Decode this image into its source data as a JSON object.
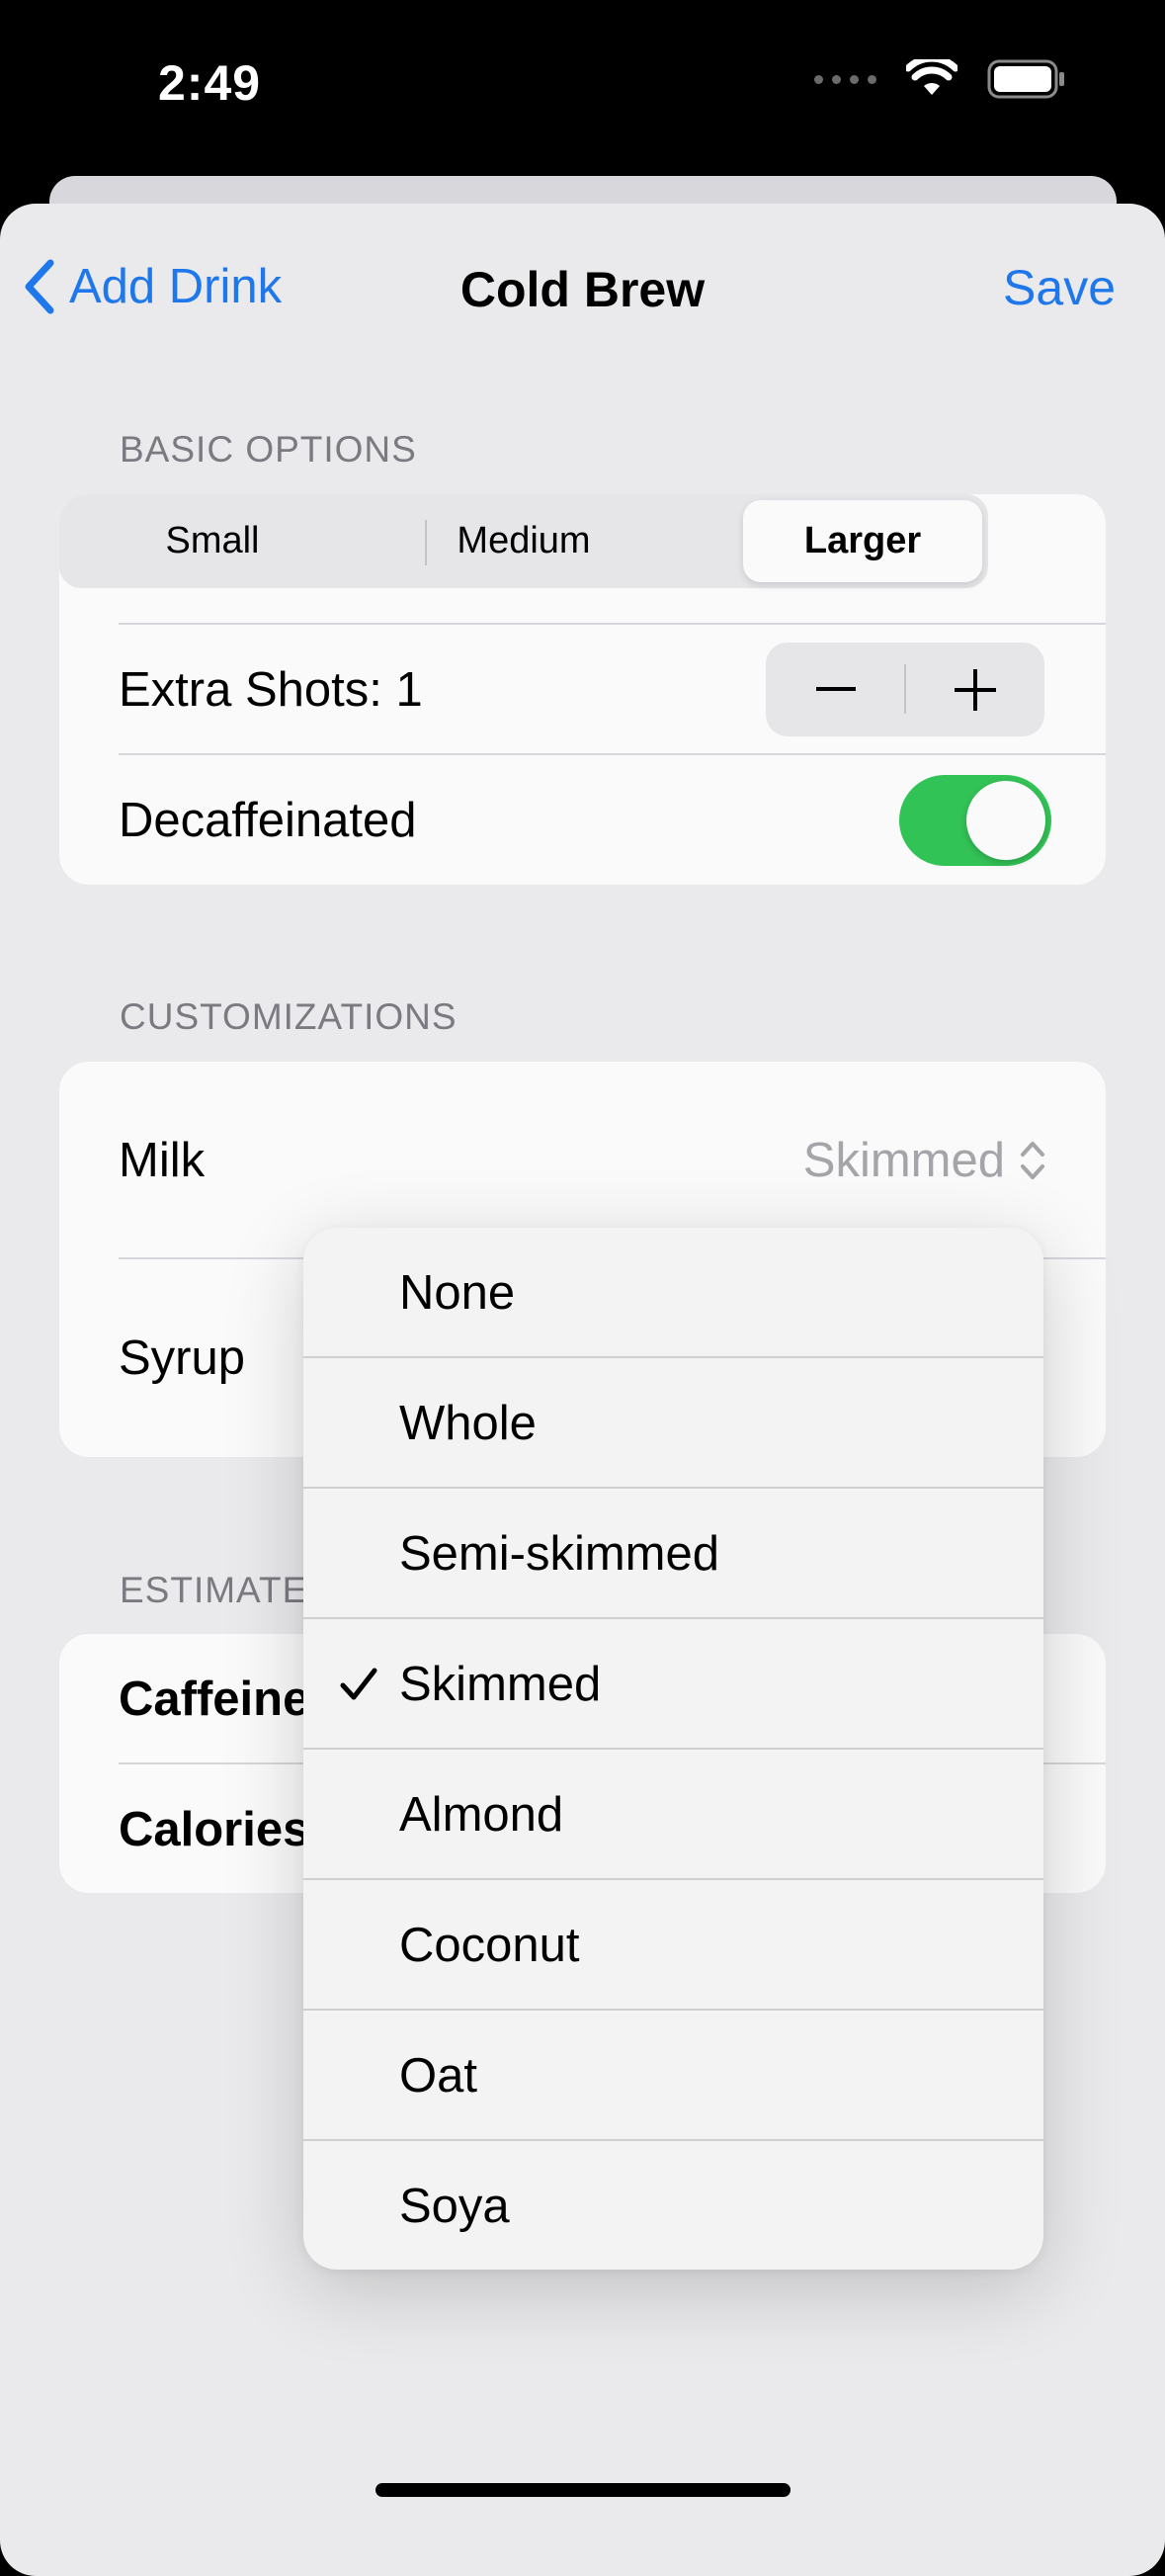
{
  "status_bar": {
    "time": "2:49"
  },
  "nav": {
    "back_label": "Add Drink",
    "title": "Cold Brew",
    "save_label": "Save"
  },
  "basic_options": {
    "header": "BASIC OPTIONS",
    "sizes": [
      "Small",
      "Medium",
      "Larger"
    ],
    "selected_size": "Larger",
    "extra_shots_label": "Extra Shots: 1",
    "decaf_label": "Decaffeinated",
    "decaf_on": true
  },
  "customizations": {
    "header": "CUSTOMIZATIONS",
    "milk_label": "Milk",
    "milk_value": "Skimmed",
    "syrup_label": "Syrup"
  },
  "estimates": {
    "header_visible": "ESTIMATE",
    "caffeine_label_visible": "Caffeine",
    "calories_label_visible": "Calories"
  },
  "milk_menu": {
    "options": [
      "None",
      "Whole",
      "Semi-skimmed",
      "Skimmed",
      "Almond",
      "Coconut",
      "Oat",
      "Soya"
    ],
    "selected": "Skimmed"
  },
  "colors": {
    "accent": "#1f7bf0",
    "toggle_on": "#34c759",
    "background": "#efeff1"
  }
}
